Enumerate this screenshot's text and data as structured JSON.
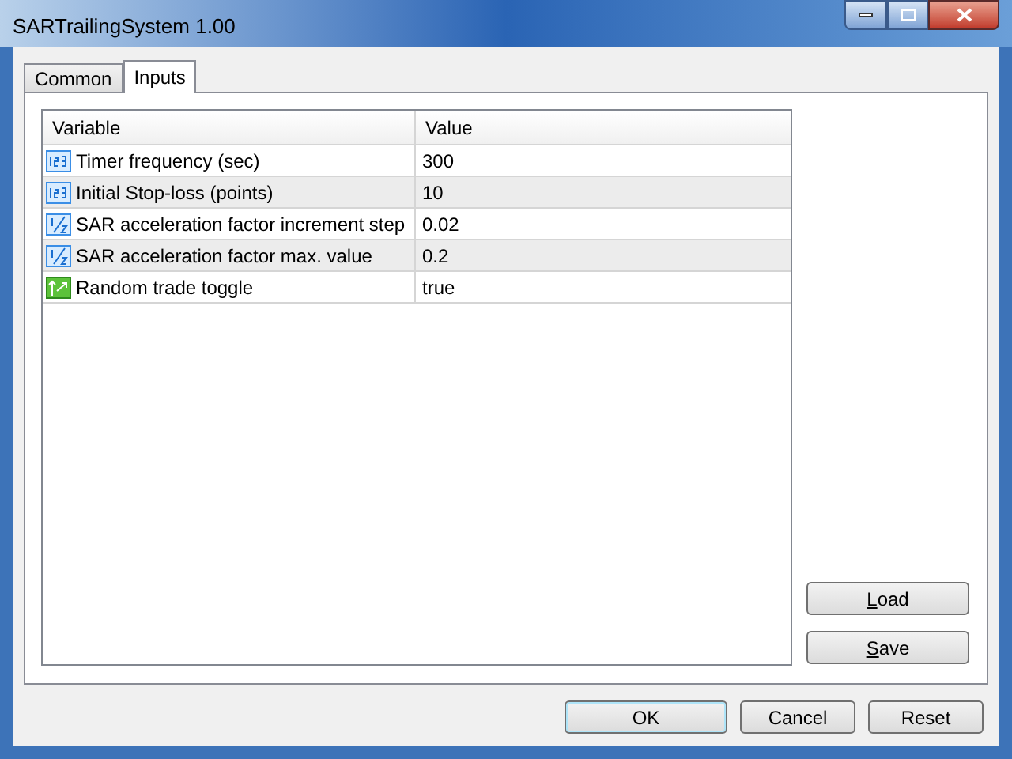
{
  "window": {
    "title": "SARTrailingSystem 1.00"
  },
  "tabs": [
    {
      "label": "Common",
      "selected": false
    },
    {
      "label": "Inputs",
      "selected": true
    }
  ],
  "table": {
    "columns": [
      "Variable",
      "Value"
    ],
    "rows": [
      {
        "kind": "integer",
        "variable": "Timer frequency (sec)",
        "value": "300"
      },
      {
        "kind": "integer",
        "variable": "Initial Stop-loss (points)",
        "value": "10"
      },
      {
        "kind": "double",
        "variable": "SAR acceleration factor increment step",
        "value": "0.02"
      },
      {
        "kind": "double",
        "variable": "SAR acceleration factor max. value",
        "value": "0.2"
      },
      {
        "kind": "boolean",
        "variable": "Random trade toggle",
        "value": "true"
      }
    ]
  },
  "side_buttons": [
    {
      "label": "Load",
      "mnemonic": true
    },
    {
      "label": "Save",
      "mnemonic": true
    }
  ],
  "footer_buttons": [
    {
      "label": "OK",
      "default": true
    },
    {
      "label": "Cancel",
      "default": false
    },
    {
      "label": "Reset",
      "default": false
    }
  ]
}
